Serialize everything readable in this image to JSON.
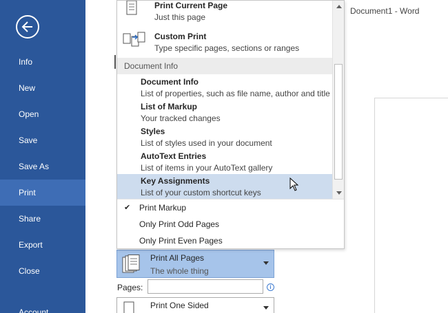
{
  "window": {
    "title": "Document1 - Word"
  },
  "sidebar": {
    "back_icon": "back-arrow-icon",
    "items": [
      {
        "label": "Info"
      },
      {
        "label": "New"
      },
      {
        "label": "Open"
      },
      {
        "label": "Save"
      },
      {
        "label": "Save As"
      },
      {
        "label": "Print",
        "active": true
      },
      {
        "label": "Share"
      },
      {
        "label": "Export"
      },
      {
        "label": "Close"
      },
      {
        "label": "Account"
      }
    ]
  },
  "dropdown": {
    "items": [
      {
        "title": "Print Current Page",
        "subtitle": "Just this page",
        "icon": "current-page-icon"
      },
      {
        "title": "Custom Print",
        "subtitle": "Type specific pages, sections or ranges",
        "icon": "custom-print-icon"
      }
    ],
    "section_header": "Document Info",
    "document_info": [
      {
        "title": "Document Info",
        "subtitle": "List of properties, such as file name, author and title"
      },
      {
        "title": "List of Markup",
        "subtitle": "Your tracked changes"
      },
      {
        "title": "Styles",
        "subtitle": "List of styles used in your document"
      },
      {
        "title": "AutoText Entries",
        "subtitle": "List of items in your AutoText gallery"
      },
      {
        "title": "Key Assignments",
        "subtitle": "List of your custom shortcut keys",
        "highlighted": true
      }
    ],
    "options": [
      {
        "label": "Print Markup",
        "checked": true
      },
      {
        "label": "Only Print Odd Pages",
        "checked": false
      },
      {
        "label": "Only Print Even Pages",
        "checked": false
      }
    ]
  },
  "settings": {
    "print_range": {
      "title": "Print All Pages",
      "subtitle": "The whole thing"
    },
    "pages_label": "Pages:",
    "pages_value": "",
    "sides": {
      "title": "Print One Sided"
    }
  },
  "colors": {
    "sidebar": "#2b579a",
    "sidebar_active": "#3e6db5",
    "highlight": "#cddcee",
    "selected_setting": "#a6c4ea"
  }
}
